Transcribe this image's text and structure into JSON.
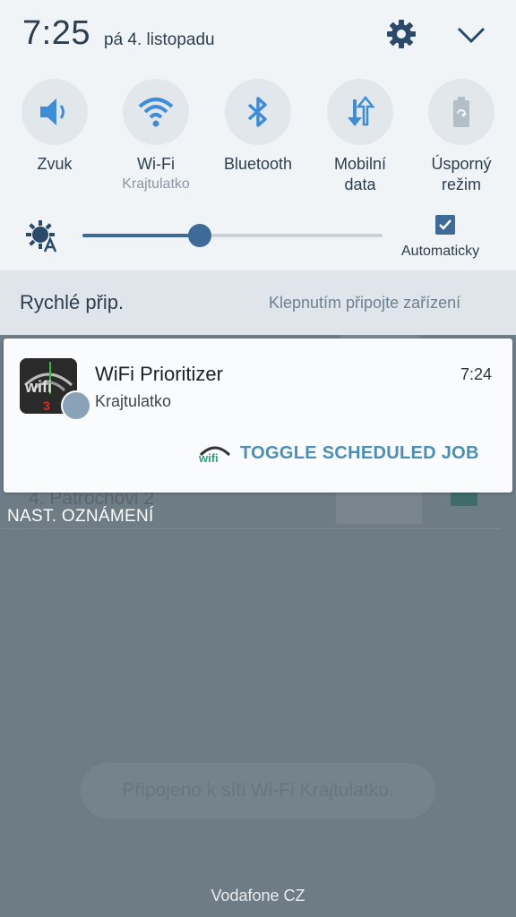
{
  "status": {
    "time": "7:25",
    "date": "pá 4. listopadu"
  },
  "header": {
    "settings_icon": "gear-icon",
    "collapse_icon": "chevron-down-icon"
  },
  "tiles": [
    {
      "label": "Zvuk",
      "sub": "",
      "icon": "speaker-icon"
    },
    {
      "label": "Wi-Fi",
      "sub": "Krajtulatko",
      "icon": "wifi-icon"
    },
    {
      "label": "Bluetooth",
      "sub": "",
      "icon": "bluetooth-icon"
    },
    {
      "label": "Mobilní",
      "label2": "data",
      "sub": "",
      "icon": "mobile-data-icon"
    },
    {
      "label": "Úsporný",
      "label2": "režim",
      "sub": "",
      "icon": "battery-saver-icon"
    }
  ],
  "brightness": {
    "level": 0.39,
    "auto_label": "Automaticky",
    "auto_checked": true
  },
  "quick_connect": {
    "title": "Rychlé přip.",
    "hint": "Klepnutím připojte zařízení"
  },
  "notification": {
    "app": "WiFi Prioritizer",
    "time": "7:24",
    "text": "Krajtulatko",
    "action": "TOGGLE SCHEDULED JOB"
  },
  "notification_settings": "NAST. OZNÁMENÍ",
  "background": {
    "row_text": "4. Patrochovi 2",
    "toast": "Připojeno k síti Wi-Fi Krajtulatko."
  },
  "carrier": "Vodafone CZ",
  "colors": {
    "accent": "#3e6a97",
    "action": "#4a8fb6",
    "panel": "#f1f4f7"
  }
}
